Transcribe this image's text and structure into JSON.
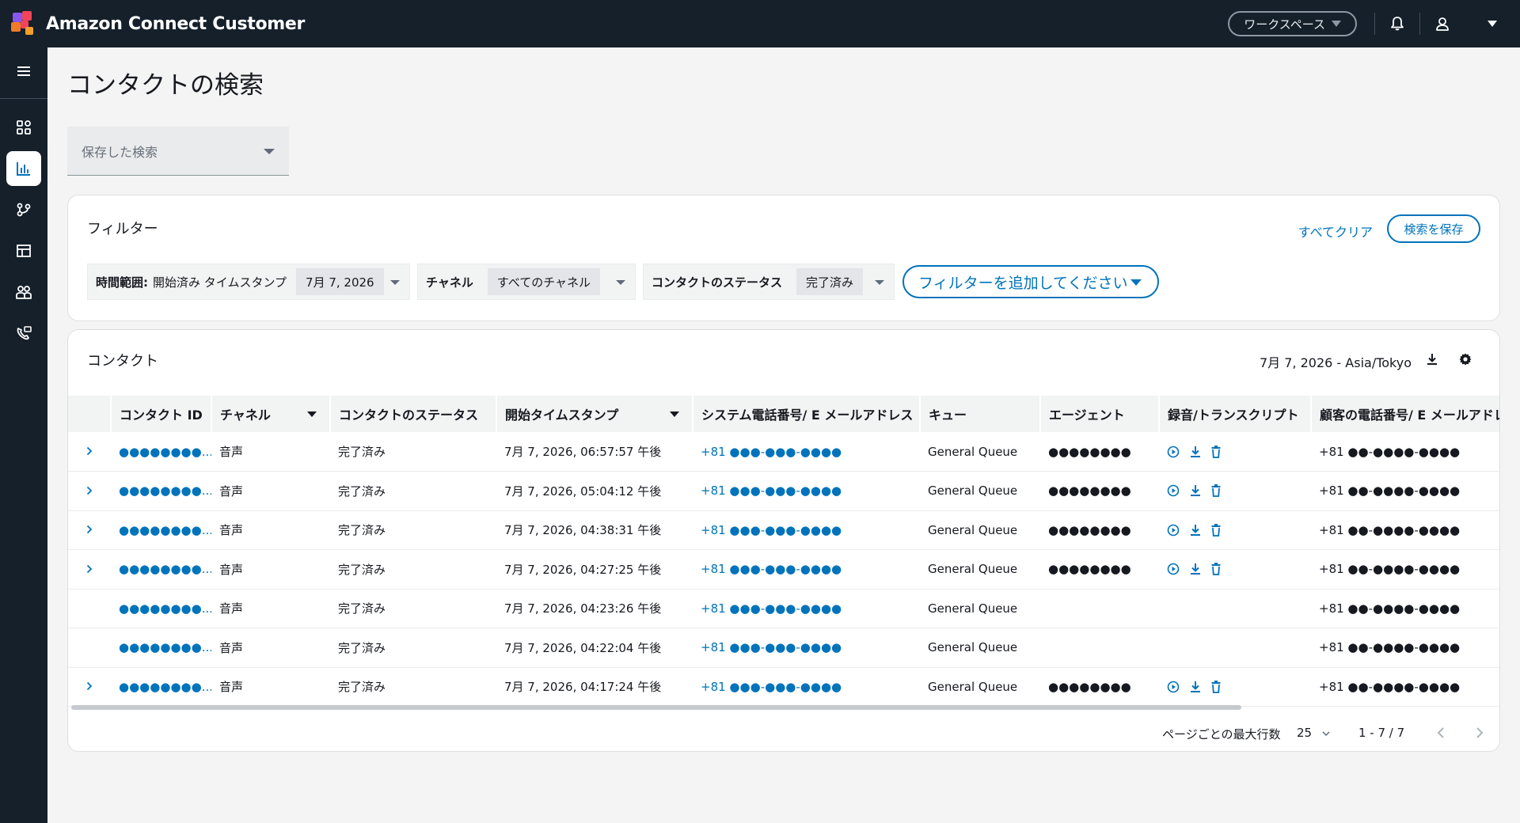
{
  "app": {
    "title": "Amazon Connect Customer"
  },
  "topbar": {
    "workspace_label": "ワークスペース",
    "icons": [
      "bell-icon",
      "user-icon",
      "caret-down-icon"
    ]
  },
  "rail": {
    "items": [
      "menu-icon",
      "dashboard-icon",
      "analytics-icon",
      "flow-icon",
      "table-icon",
      "users-icon",
      "phone-icon"
    ],
    "active": "analytics-icon"
  },
  "page": {
    "title": "コンタクトの検索",
    "saved_search_placeholder": "保存した検索"
  },
  "filters": {
    "title": "フィルター",
    "clear_all": "すべてクリア",
    "save_search": "検索を保存",
    "chips": [
      {
        "label": "時間範囲:",
        "sub": "開始済み タイムスタンプ",
        "value": "7月 7, 2026"
      },
      {
        "label": "チャネル",
        "sub": "",
        "value": "すべてのチャネル"
      },
      {
        "label": "コンタクトのステータス",
        "sub": "",
        "value": "完了済み"
      }
    ],
    "add_filter": "フィルターを追加してください"
  },
  "contacts": {
    "title": "コンタクト",
    "date_tz": "7月 7, 2026 - Asia/Tokyo",
    "columns": [
      "コンタクト ID",
      "チャネル",
      "コンタクトのステータス",
      "開始タイムスタンプ",
      "システム電話番号/ E メールアドレス",
      "キュー",
      "エージェント",
      "録音/トランスクリプト",
      "顧客の電話番号/ E メールアドレス"
    ],
    "rows": [
      {
        "expandable": true,
        "id": "●●●●●●●●...",
        "channel": "音声",
        "status": "完了済み",
        "start": "7月 7, 2026, 06:57:57 午後",
        "system_phone": "+81 ●●●-●●●-●●●●",
        "queue": "General Queue",
        "agent": "●●●●●●●●",
        "has_recording": true,
        "customer_phone": "+81 ●●-●●●●-●●●●"
      },
      {
        "expandable": true,
        "id": "●●●●●●●●...",
        "channel": "音声",
        "status": "完了済み",
        "start": "7月 7, 2026, 05:04:12 午後",
        "system_phone": "+81 ●●●-●●●-●●●●",
        "queue": "General Queue",
        "agent": "●●●●●●●●",
        "has_recording": true,
        "customer_phone": "+81 ●●-●●●●-●●●●"
      },
      {
        "expandable": true,
        "id": "●●●●●●●●...",
        "channel": "音声",
        "status": "完了済み",
        "start": "7月 7, 2026, 04:38:31 午後",
        "system_phone": "+81 ●●●-●●●-●●●●",
        "queue": "General Queue",
        "agent": "●●●●●●●●",
        "has_recording": true,
        "customer_phone": "+81 ●●-●●●●-●●●●"
      },
      {
        "expandable": true,
        "id": "●●●●●●●●...",
        "channel": "音声",
        "status": "完了済み",
        "start": "7月 7, 2026, 04:27:25 午後",
        "system_phone": "+81 ●●●-●●●-●●●●",
        "queue": "General Queue",
        "agent": "●●●●●●●●",
        "has_recording": true,
        "customer_phone": "+81 ●●-●●●●-●●●●"
      },
      {
        "expandable": false,
        "id": "●●●●●●●●...",
        "channel": "音声",
        "status": "完了済み",
        "start": "7月 7, 2026, 04:23:26 午後",
        "system_phone": "+81 ●●●-●●●-●●●●",
        "queue": "General Queue",
        "agent": "",
        "has_recording": false,
        "customer_phone": "+81 ●●-●●●●-●●●●"
      },
      {
        "expandable": false,
        "id": "●●●●●●●●...",
        "channel": "音声",
        "status": "完了済み",
        "start": "7月 7, 2026, 04:22:04 午後",
        "system_phone": "+81 ●●●-●●●-●●●●",
        "queue": "General Queue",
        "agent": "",
        "has_recording": false,
        "customer_phone": "+81 ●●-●●●●-●●●●"
      },
      {
        "expandable": true,
        "id": "●●●●●●●●...",
        "channel": "音声",
        "status": "完了済み",
        "start": "7月 7, 2026, 04:17:24 午後",
        "system_phone": "+81 ●●●-●●●-●●●●",
        "queue": "General Queue",
        "agent": "●●●●●●●●",
        "has_recording": true,
        "customer_phone": "+81 ●●-●●●●-●●●●"
      }
    ],
    "pager": {
      "rows_per_page_label": "ページごとの最大行数",
      "rows_per_page": "25",
      "range": "1 - 7 / 7"
    }
  },
  "colors": {
    "topbar_bg": "#15202b",
    "accent": "#0073bb",
    "header_bg": "#f2f3f3"
  }
}
